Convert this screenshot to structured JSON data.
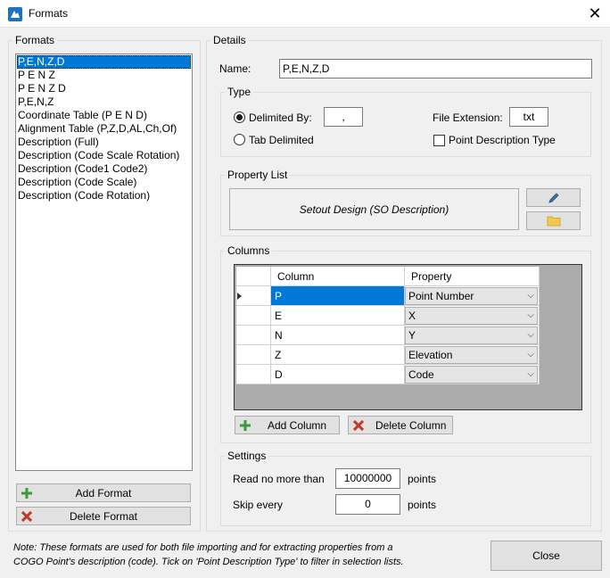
{
  "window": {
    "title": "Formats",
    "close_glyph": "✕"
  },
  "formats": {
    "legend": "Formats",
    "items": [
      "P,E,N,Z,D",
      "P E N Z",
      "P E N Z D",
      "P,E,N,Z",
      "Coordinate Table (P E N D)",
      "Alignment Table (P,Z,D,AL,Ch,Of)",
      "Description (Full)",
      "Description (Code Scale Rotation)",
      "Description (Code1 Code2)",
      "Description (Code Scale)",
      "Description (Code Rotation)"
    ],
    "selected_index": 0,
    "add_label": "Add Format",
    "delete_label": "Delete Format"
  },
  "details": {
    "legend": "Details",
    "name_label": "Name:",
    "name_value": "P,E,N,Z,D",
    "type": {
      "legend": "Type",
      "delimited_label": "Delimited By:",
      "delimiter_value": ",",
      "tab_label": "Tab Delimited",
      "file_ext_label": "File Extension:",
      "file_ext_value": "txt",
      "point_desc_label": "Point Description Type"
    },
    "property_list": {
      "legend": "Property List",
      "value": "Setout Design (SO Description)"
    },
    "columns": {
      "legend": "Columns",
      "header_column": "Column",
      "header_property": "Property",
      "rows": [
        {
          "column": "P",
          "property": "Point Number"
        },
        {
          "column": "E",
          "property": "X"
        },
        {
          "column": "N",
          "property": "Y"
        },
        {
          "column": "Z",
          "property": "Elevation"
        },
        {
          "column": "D",
          "property": "Code"
        }
      ],
      "add_label": "Add Column",
      "delete_label": "Delete Column"
    },
    "settings": {
      "legend": "Settings",
      "read_label": "Read no more than",
      "read_value": "10000000",
      "read_unit": "points",
      "skip_label": "Skip every",
      "skip_value": "0",
      "skip_unit": "points"
    }
  },
  "footer": {
    "note_line1": "Note: These formats are used for both file importing and for extracting properties from a",
    "note_line2": "COGO Point's description (code). Tick on 'Point Description Type' to filter in selection lists.",
    "close_label": "Close"
  },
  "colors": {
    "accent": "#0078d7",
    "add_icon": "#3c9a3c",
    "delete_icon": "#c0392b"
  }
}
